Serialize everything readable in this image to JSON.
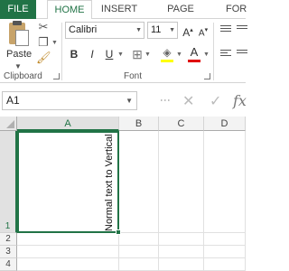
{
  "ribbon_tabs": [
    "FILE",
    "HOME",
    "INSERT",
    "PAGE LAYOUT",
    "FOR"
  ],
  "clipboard": {
    "paste_label": "Paste",
    "group_label": "Clipboard"
  },
  "font": {
    "name": "Calibri",
    "size": "11",
    "grow_label": "A",
    "shrink_label": "A",
    "bold_label": "B",
    "italic_label": "I",
    "underline_label": "U",
    "font_color_label": "A",
    "group_label": "Font"
  },
  "colors": {
    "accent": "#217346",
    "highlight": "#ffff00",
    "font_color": "#e00000"
  },
  "formula_bar": {
    "name_box": "A1",
    "fx_label": "fx"
  },
  "sheet": {
    "columns": [
      "A",
      "B",
      "C",
      "D"
    ],
    "rows": [
      "1",
      "2",
      "3",
      "4"
    ],
    "active_cell_text": "Normal text to Vertical"
  }
}
